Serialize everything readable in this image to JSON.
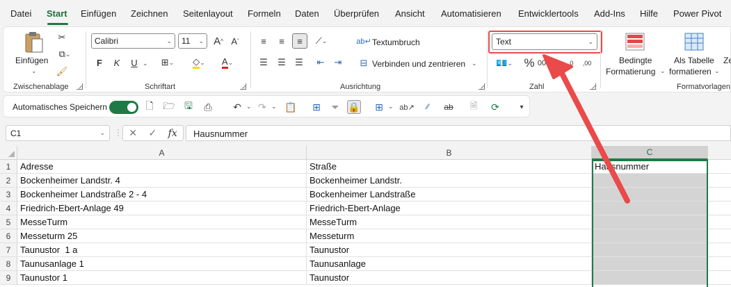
{
  "menu": {
    "items": [
      "Datei",
      "Start",
      "Einfügen",
      "Zeichnen",
      "Seitenlayout",
      "Formeln",
      "Daten",
      "Überprüfen",
      "Ansicht",
      "Automatisieren",
      "Entwicklertools",
      "Add-Ins",
      "Hilfe",
      "Power Pivot"
    ],
    "active": "Start"
  },
  "ribbon": {
    "clipboard": {
      "paste_label": "Einfügen",
      "group_label": "Zwischenablage"
    },
    "font": {
      "font_name": "Calibri",
      "font_size": "11",
      "group_label": "Schriftart",
      "bold": "F",
      "italic": "K",
      "underline": "U"
    },
    "alignment": {
      "wrap_text": "Textumbruch",
      "merge_center": "Verbinden und zentrieren",
      "group_label": "Ausrichtung"
    },
    "number": {
      "format": "Text",
      "percent": "%",
      "group_label": "Zahl"
    },
    "styles": {
      "conditional_line1": "Bedingte",
      "conditional_line2": "Formatierung",
      "table_line1": "Als Tabelle",
      "table_line2": "formatieren",
      "group_label": "Formatvorlagen",
      "cut_label": "Ze"
    }
  },
  "qat": {
    "autosave_label": "Automatisches Speichern"
  },
  "formula_bar": {
    "name_box": "C1",
    "fx": "fx",
    "content": "Hausnummer"
  },
  "sheet": {
    "columns": [
      "A",
      "B",
      "C"
    ],
    "rows": [
      {
        "num": "1",
        "a": "Adresse",
        "b": "Straße",
        "c": "Hausnummer"
      },
      {
        "num": "2",
        "a": "Bockenheimer Landstr. 4",
        "b": "Bockenheimer Landstr.",
        "c": ""
      },
      {
        "num": "3",
        "a": "Bockenheimer Landstraße 2 - 4",
        "b": "Bockenheimer Landstraße",
        "c": ""
      },
      {
        "num": "4",
        "a": "Friedrich-Ebert-Anlage 49",
        "b": "Friedrich-Ebert-Anlage",
        "c": ""
      },
      {
        "num": "5",
        "a": "MesseTurm",
        "b": "MesseTurm",
        "c": ""
      },
      {
        "num": "6",
        "a": "Messeturm 25",
        "b": "Messeturm",
        "c": ""
      },
      {
        "num": "7",
        "a": "Taunustor  1 a",
        "b": "Taunustor",
        "c": ""
      },
      {
        "num": "8",
        "a": "Taunusanlage 1",
        "b": "Taunusanlage",
        "c": ""
      },
      {
        "num": "9",
        "a": "Taunustor 1",
        "b": "Taunustor",
        "c": ""
      }
    ]
  },
  "colors": {
    "accent": "#1e7a45",
    "highlight": "#ea4a4a",
    "selection_fill": "#d4d4d4"
  }
}
